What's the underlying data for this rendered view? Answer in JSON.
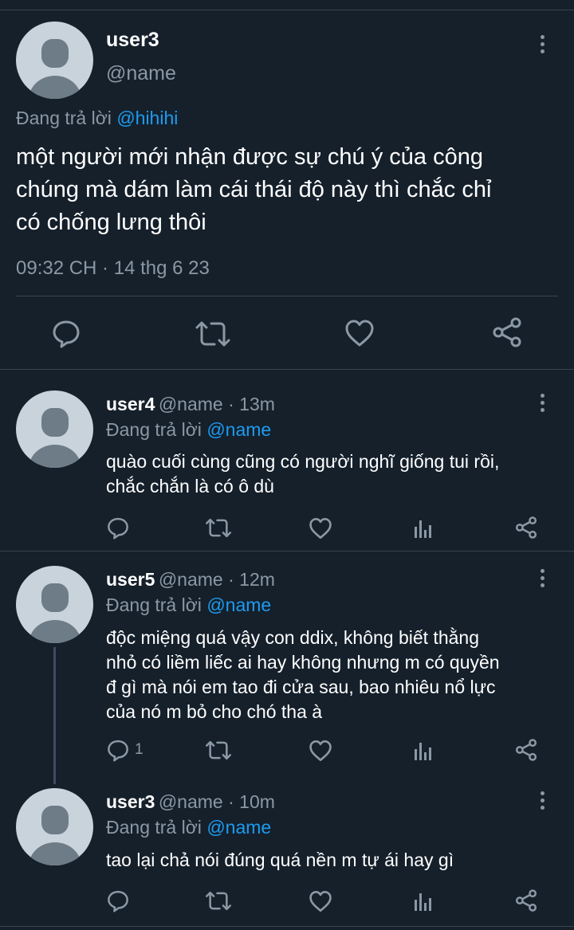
{
  "main_tweet": {
    "display_name": "user3",
    "handle": "@name",
    "replying_prefix": "Đang trả lời",
    "replying_to": "@hihihi",
    "text_lines": [
      "một người mới nhận được sự chú ý của công",
      "chúng mà dám làm cái thái độ này thì chắc chỉ",
      "có chống lưng thôi"
    ],
    "timestamp": "09:32 CH · 14 thg 6 23"
  },
  "replies": [
    {
      "display_name": "user4",
      "handle": "@name",
      "time": "13m",
      "replying_prefix": "Đang trả lời",
      "replying_to": "@name",
      "text_lines": [
        "quào cuối cùng cũng có người nghĩ giống tui rồi,",
        "chắc chắn là có ô dù"
      ],
      "reply_count": ""
    },
    {
      "display_name": "user5",
      "handle": "@name",
      "time": "12m",
      "replying_prefix": "Đang trả lời",
      "replying_to": "@name",
      "text_lines": [
        "độc miệng quá vậy con ddix, không biết thằng",
        "nhỏ có liềm liếc ai hay không nhưng m có quyền",
        "đ gì mà nói em tao đi cửa sau, bao nhiêu nổ lực",
        "của nó m bỏ cho chó tha à"
      ],
      "reply_count": "1"
    },
    {
      "display_name": "user3",
      "handle": "@name",
      "time": "10m",
      "replying_prefix": "Đang trả lời",
      "replying_to": "@name",
      "text_lines": [
        "tao lại chả nói đúng quá nền m tự ái hay gì"
      ],
      "reply_count": ""
    }
  ],
  "separator": " · ",
  "colors": {
    "background": "#15202b",
    "text": "#ffffff",
    "secondary": "#8b98a5",
    "mention": "#1d9bf0",
    "divider": "#38444d"
  },
  "icons": [
    "reply-icon",
    "retweet-icon",
    "like-icon",
    "analytics-icon",
    "share-icon",
    "more-icon"
  ]
}
